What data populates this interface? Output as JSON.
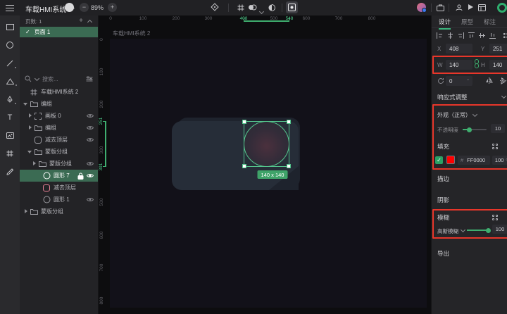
{
  "topbar": {
    "title": "车载HMI系统",
    "zoom": "89%"
  },
  "pages": {
    "header": "页数: 1",
    "page": "页面 1"
  },
  "search": {
    "placeholder": "搜索..."
  },
  "layers": [
    {
      "label": "车载HMI系统 2"
    },
    {
      "label": "编组"
    },
    {
      "label": "画板 0"
    },
    {
      "label": "编组"
    },
    {
      "label": "减去顶层"
    },
    {
      "label": "蒙版分组"
    },
    {
      "label": "蒙版分组"
    },
    {
      "label": "圆形 7"
    },
    {
      "label": "减去顶层"
    },
    {
      "label": "圆形 1"
    },
    {
      "label": "蒙版分组"
    }
  ],
  "canvas": {
    "artboard_label": "车载HMI系统 2",
    "badge": "140 x 140",
    "h_ticks": [
      "0",
      "100",
      "200",
      "300",
      "500",
      "600",
      "700",
      "800"
    ],
    "h_sel": [
      "408",
      "548"
    ],
    "v_ticks": [
      "0",
      "100",
      "200",
      "300",
      "500",
      "600",
      "700",
      "800"
    ],
    "v_sel": [
      "251",
      "391"
    ]
  },
  "inspector": {
    "tabs": [
      "设计",
      "原型",
      "标注"
    ],
    "x_label": "X",
    "x": "408",
    "y_label": "Y",
    "y": "251",
    "w_label": "W",
    "w": "140",
    "h_label": "H",
    "h": "140",
    "rotation": "0",
    "degree": "°",
    "responsive": "响应式调整",
    "appearance": "外观（正常）",
    "opacity_label": "不透明度",
    "opacity": "10",
    "percent": "%",
    "fill_header": "填充",
    "hash": "#",
    "fill_hex": "FF0000",
    "fill_opacity": "100",
    "stroke_header": "描边",
    "shadow_header": "阴影",
    "blur_header": "模糊",
    "blur_type": "高斯模糊",
    "blur_value": "100",
    "export_header": "导出"
  },
  "colors": {
    "accent": "#3CB57C",
    "selection": "#4EC98A",
    "fill_red": "#FF0000",
    "annotation": "#E8362A"
  }
}
